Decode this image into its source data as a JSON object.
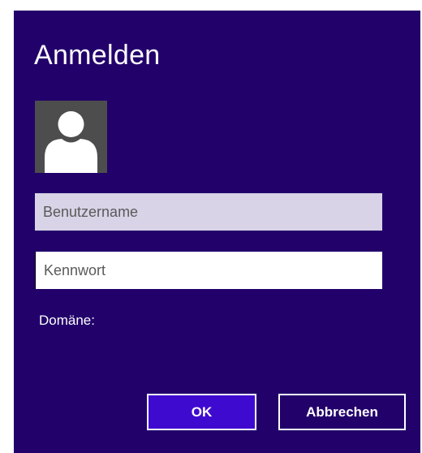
{
  "dialog": {
    "title": "Anmelden",
    "avatar_icon": "user-silhouette-icon",
    "username": {
      "value": "",
      "placeholder": "Benutzername"
    },
    "password": {
      "value": "",
      "placeholder": "Kennwort"
    },
    "domain_label": "Domäne:",
    "ok_label": "OK",
    "cancel_label": "Abbrechen"
  },
  "colors": {
    "dialog_background": "#22016b",
    "ok_button_background": "#3f0ad0",
    "username_field_background": "#d8d3e6",
    "avatar_background": "#4d4d4d"
  }
}
